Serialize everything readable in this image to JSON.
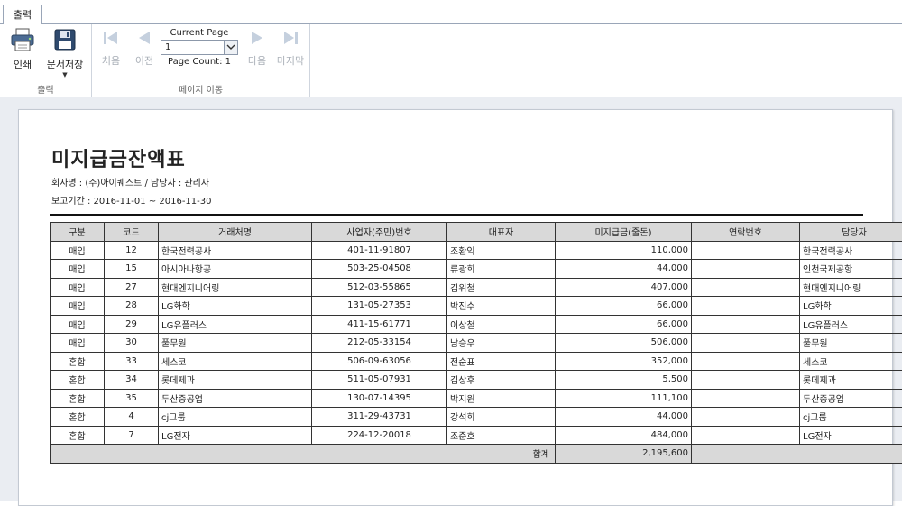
{
  "tab": {
    "label": "출력"
  },
  "ribbon": {
    "output_group": {
      "label": "출력",
      "print_label": "인쇄",
      "save_label": "문서저장"
    },
    "nav_group": {
      "label": "페이지 이동",
      "first_label": "처음",
      "prev_label": "이전",
      "next_label": "다음",
      "last_label": "마지막",
      "current_page_title": "Current Page",
      "current_page_value": "1",
      "page_count": "Page Count: 1"
    }
  },
  "report": {
    "title": "미지급금잔액표",
    "company_line": "회사명 : (주)아이퀘스트 / 담당자 : 관리자",
    "period_line": "보고기간 : 2016-11-01 ~ 2016-11-30",
    "columns": [
      "구분",
      "코드",
      "거래처명",
      "사업자(주민)번호",
      "대표자",
      "미지급금(줄돈)",
      "연락번호",
      "담당자"
    ],
    "rows": [
      {
        "type": "매입",
        "code": "12",
        "name": "한국전력공사",
        "bizno": "401-11-91807",
        "ceo": "조환익",
        "amount": "110,000",
        "phone": "",
        "manager": "한국전력공사"
      },
      {
        "type": "매입",
        "code": "15",
        "name": "아시아나항공",
        "bizno": "503-25-04508",
        "ceo": "류광희",
        "amount": "44,000",
        "phone": "",
        "manager": "인천국제공항"
      },
      {
        "type": "매입",
        "code": "27",
        "name": "현대엔지니어링",
        "bizno": "512-03-55865",
        "ceo": "김위철",
        "amount": "407,000",
        "phone": "",
        "manager": "현대엔지니어링"
      },
      {
        "type": "매입",
        "code": "28",
        "name": "LG화학",
        "bizno": "131-05-27353",
        "ceo": "박진수",
        "amount": "66,000",
        "phone": "",
        "manager": "LG화학"
      },
      {
        "type": "매입",
        "code": "29",
        "name": "LG유플러스",
        "bizno": "411-15-61771",
        "ceo": "이상철",
        "amount": "66,000",
        "phone": "",
        "manager": "LG유플러스"
      },
      {
        "type": "매입",
        "code": "30",
        "name": "풀무원",
        "bizno": "212-05-33154",
        "ceo": "남승우",
        "amount": "506,000",
        "phone": "",
        "manager": "풀무원"
      },
      {
        "type": "혼합",
        "code": "33",
        "name": "세스코",
        "bizno": "506-09-63056",
        "ceo": "전순표",
        "amount": "352,000",
        "phone": "",
        "manager": "세스코"
      },
      {
        "type": "혼합",
        "code": "34",
        "name": "롯데제과",
        "bizno": "511-05-07931",
        "ceo": "김상후",
        "amount": "5,500",
        "phone": "",
        "manager": "롯데제과"
      },
      {
        "type": "혼합",
        "code": "35",
        "name": "두산중공업",
        "bizno": "130-07-14395",
        "ceo": "박지원",
        "amount": "111,100",
        "phone": "",
        "manager": "두산중공업"
      },
      {
        "type": "혼합",
        "code": "4",
        "name": "cj그룹",
        "bizno": "311-29-43731",
        "ceo": "강석희",
        "amount": "44,000",
        "phone": "",
        "manager": "cj그룹"
      },
      {
        "type": "혼합",
        "code": "7",
        "name": "LG전자",
        "bizno": "224-12-20018",
        "ceo": "조준호",
        "amount": "484,000",
        "phone": "",
        "manager": "LG전자"
      }
    ],
    "total_label": "합계",
    "total_amount": "2,195,600"
  }
}
